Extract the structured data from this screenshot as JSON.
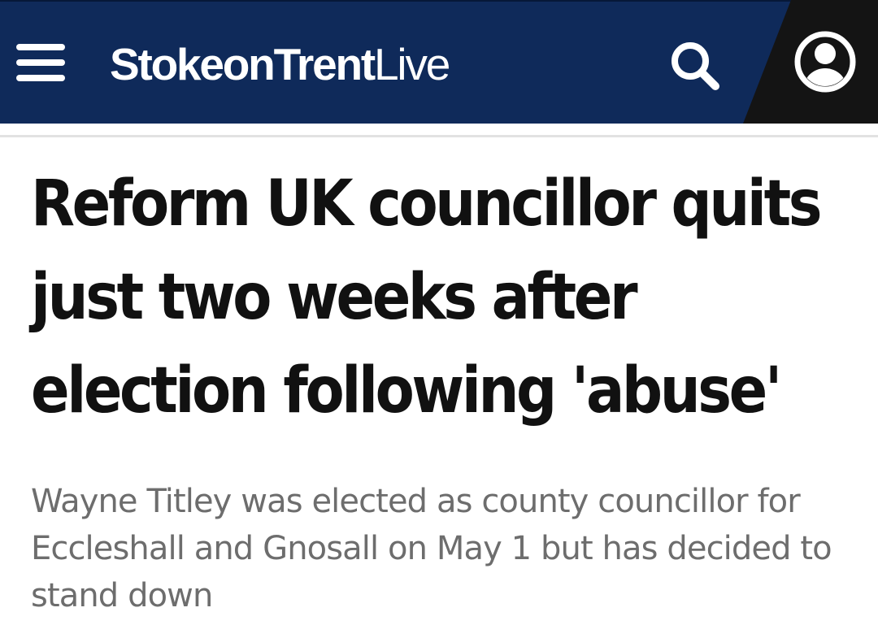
{
  "header": {
    "brand": {
      "part_bold": "StokeonTrent",
      "part_light": "Live"
    },
    "icons": {
      "menu": "hamburger-menu-icon",
      "search": "search-icon",
      "account": "user-account-icon"
    },
    "colors": {
      "background": "#0f2a5a",
      "account_panel": "#141414",
      "foreground": "#ffffff"
    }
  },
  "article": {
    "headline": "Reform UK councillor quits just two weeks after election following 'abuse'",
    "standfirst": "Wayne Titley was elected as county councillor for Eccleshall and Gnosall on May 1 but has decided to stand down"
  }
}
